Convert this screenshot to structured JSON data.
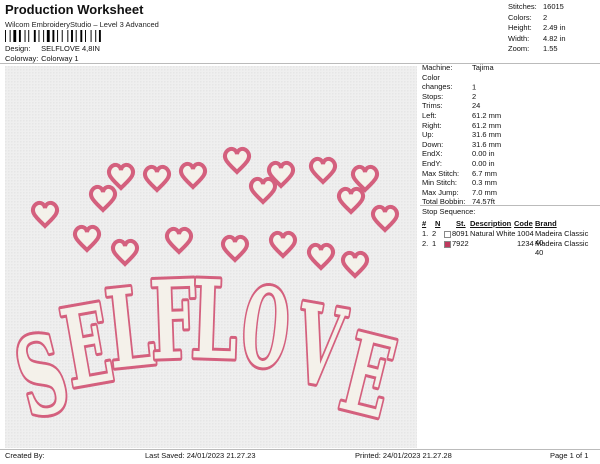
{
  "header": {
    "title": "Production Worksheet",
    "subtitle": "Wilcom EmbroideryStudio – Level 3 Advanced",
    "design_label": "Design:",
    "design_value": "SELFLOVE 4,8IN",
    "colorway_label": "Colorway:",
    "colorway_value": "Colorway 1"
  },
  "summary": [
    {
      "label": "Stitches:",
      "value": "16015"
    },
    {
      "label": "Colors:",
      "value": "2"
    },
    {
      "label": "Height:",
      "value": "2.49 in"
    },
    {
      "label": "Width:",
      "value": "4.82 in"
    },
    {
      "label": "Zoom:",
      "value": "1.55"
    }
  ],
  "machine": [
    {
      "label": "Machine:",
      "value": "Tajima"
    },
    {
      "label": "Color changes:",
      "value": "1"
    },
    {
      "label": "Stops:",
      "value": "2"
    },
    {
      "label": "Trims:",
      "value": "24"
    },
    {
      "label": "Left:",
      "value": "61.2 mm"
    },
    {
      "label": "Right:",
      "value": "61.2 mm"
    },
    {
      "label": "Up:",
      "value": "31.6 mm"
    },
    {
      "label": "Down:",
      "value": "31.6 mm"
    },
    {
      "label": "EndX:",
      "value": "0.00 in"
    },
    {
      "label": "EndY:",
      "value": "0.00 in"
    },
    {
      "label": "Max Stitch:",
      "value": "6.7 mm"
    },
    {
      "label": "Min Stitch:",
      "value": "0.3 mm"
    },
    {
      "label": "Max Jump:",
      "value": "7.0 mm"
    },
    {
      "label": "Total Bobbin:",
      "value": "74.57ft"
    }
  ],
  "stop_sequence": {
    "title": "Stop Sequence:",
    "headers": {
      "num": "#",
      "n": "N",
      "st": "St.",
      "description": "Description",
      "code": "Code",
      "brand": "Brand"
    },
    "rows": [
      {
        "num": "1.",
        "n": "2",
        "color": "#ffffff",
        "st": "8091",
        "description": "Natural White",
        "code": "1004",
        "brand": "Madeira Classic 40"
      },
      {
        "num": "2.",
        "n": "1",
        "color": "#c0395e",
        "st": "7922",
        "description": "",
        "code": "1234",
        "brand": "Madeira Classic 40"
      }
    ]
  },
  "design_text": "SELFLOVE",
  "colors": {
    "fill": "#f4f1ea",
    "outline": "#d4607e",
    "outline_dark": "#b8405f",
    "background": "#efefef"
  },
  "footer": {
    "created_by": "Created By:",
    "last_saved": "Last Saved: 24/01/2023 21.27.23",
    "printed": "Printed: 24/01/2023 21.27.28",
    "page": "Page 1 of 1"
  }
}
